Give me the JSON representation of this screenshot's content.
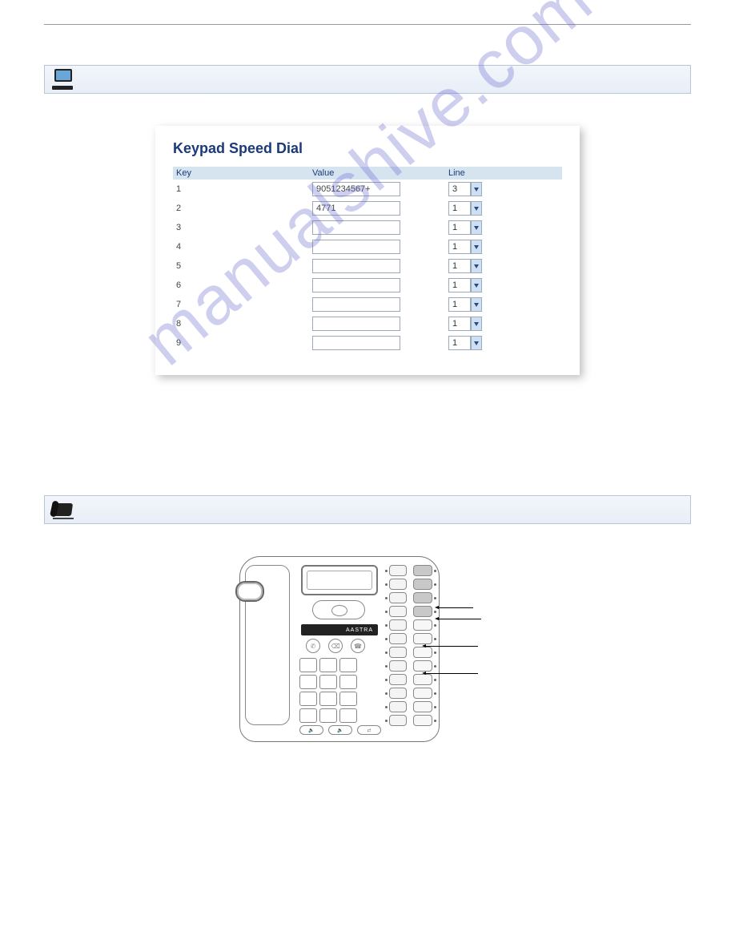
{
  "watermark": "manualshive.com",
  "brand": "AASTRA",
  "table": {
    "title": "Keypad Speed Dial",
    "headers": {
      "key": "Key",
      "value": "Value",
      "line": "Line"
    },
    "rows": [
      {
        "key": "1",
        "value": "9051234567+",
        "line": "3"
      },
      {
        "key": "2",
        "value": "4771",
        "line": "1"
      },
      {
        "key": "3",
        "value": "",
        "line": "1"
      },
      {
        "key": "4",
        "value": "",
        "line": "1"
      },
      {
        "key": "5",
        "value": "",
        "line": "1"
      },
      {
        "key": "6",
        "value": "",
        "line": "1"
      },
      {
        "key": "7",
        "value": "",
        "line": "1"
      },
      {
        "key": "8",
        "value": "",
        "line": "1"
      },
      {
        "key": "9",
        "value": "",
        "line": "1"
      }
    ]
  }
}
